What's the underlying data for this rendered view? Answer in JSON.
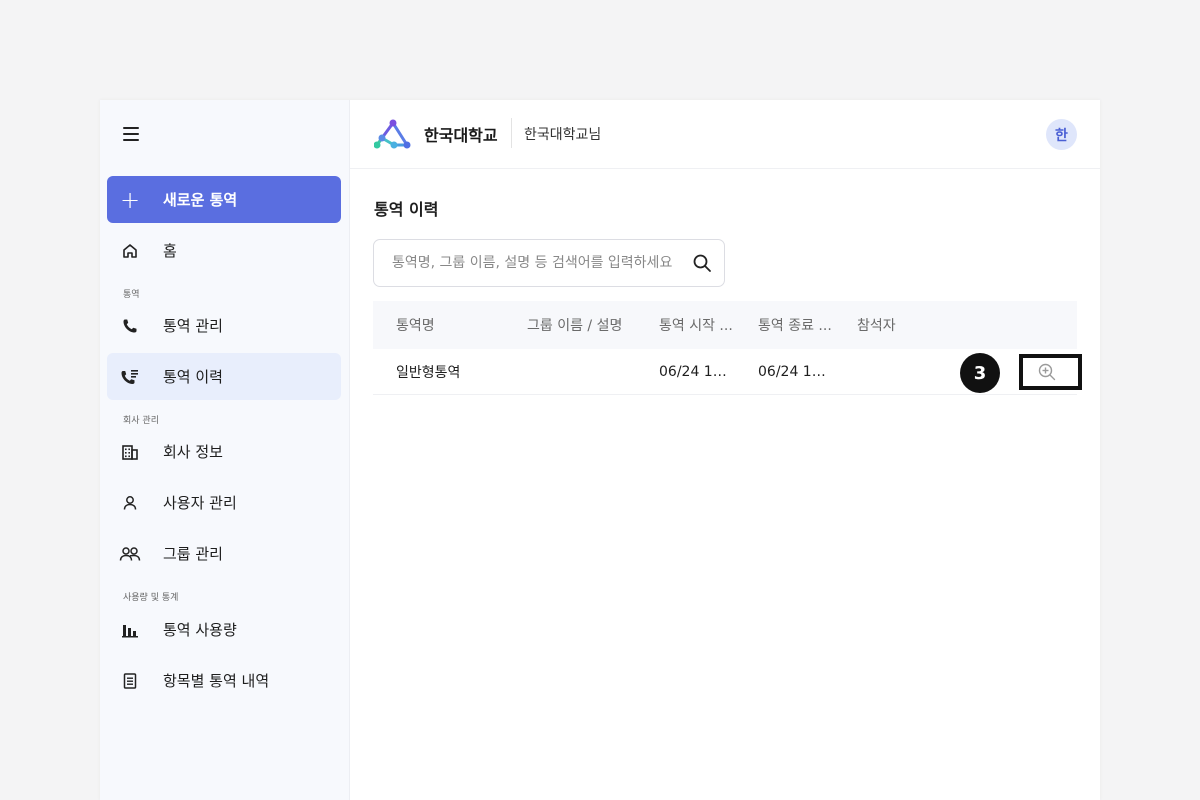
{
  "sidebar": {
    "new_button_label": "새로운 통역",
    "home_label": "홈",
    "section_interpretation": "통역",
    "interp_manage_label": "통역 관리",
    "interp_history_label": "통역 이력",
    "section_company": "회사 관리",
    "company_info_label": "회사 정보",
    "user_manage_label": "사용자 관리",
    "group_manage_label": "그룹 관리",
    "section_usage": "사용량 및 통계",
    "usage_label": "통역 사용량",
    "itemized_label": "항목별 통역 내역"
  },
  "header": {
    "brand": "한국대학교",
    "user_name": "한국대학교님",
    "avatar_initial": "한"
  },
  "main": {
    "title": "통역 이력",
    "search_placeholder": "통역명, 그룹 이름, 설명 등 검색어를 입력하세요",
    "search_value": "",
    "table": {
      "headers": [
        "통역명",
        "그룹 이름 / 설명",
        "통역 시작 ...",
        "통역 종료 ...",
        "참석자"
      ],
      "rows": [
        [
          "일반형통역",
          "",
          "06/24 13:...",
          "06/24 13:...",
          ""
        ]
      ]
    },
    "step_badge": "3"
  },
  "colors": {
    "accent": "#5a6ee0",
    "active_bg": "#e8eefc",
    "sidebar_bg": "#f7f9fd"
  },
  "icons": {
    "menu": "hamburger-icon",
    "new": "plus-icon",
    "home": "home-icon",
    "phone": "phone-icon",
    "history": "phone-list-icon",
    "company": "building-icon",
    "user": "person-icon",
    "group": "people-icon",
    "usage": "bar-chart-icon",
    "itemized": "document-icon",
    "search": "search-icon",
    "detail": "zoom-in-icon"
  }
}
